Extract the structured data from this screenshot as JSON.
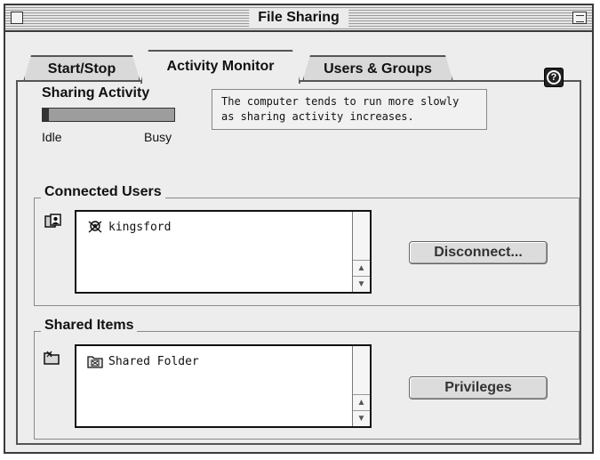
{
  "window": {
    "title": "File Sharing"
  },
  "tabs": [
    {
      "label": "Start/Stop",
      "active": false
    },
    {
      "label": "Activity Monitor",
      "active": true
    },
    {
      "label": "Users & Groups",
      "active": false
    }
  ],
  "help": {
    "icon": "question-icon",
    "glyph": "?"
  },
  "sharing_activity": {
    "title": "Sharing Activity",
    "level": 0.05,
    "min_label": "Idle",
    "max_label": "Busy",
    "note_line1": "The computer tends to run more slowly",
    "note_line2": "as sharing activity increases."
  },
  "connected_users": {
    "title": "Connected Users",
    "icon": "users-icon",
    "items": [
      {
        "label": "kingsford",
        "icon": "user-icon"
      }
    ],
    "button_label": "Disconnect..."
  },
  "shared_items": {
    "title": "Shared Items",
    "icon": "folder-icon",
    "items": [
      {
        "label": "Shared Folder",
        "icon": "shared-folder-icon"
      }
    ],
    "button_label": "Privileges"
  },
  "colors": {
    "panel": "#ededed",
    "meter_track": "#9d9d9d",
    "meter_fill": "#333333"
  }
}
